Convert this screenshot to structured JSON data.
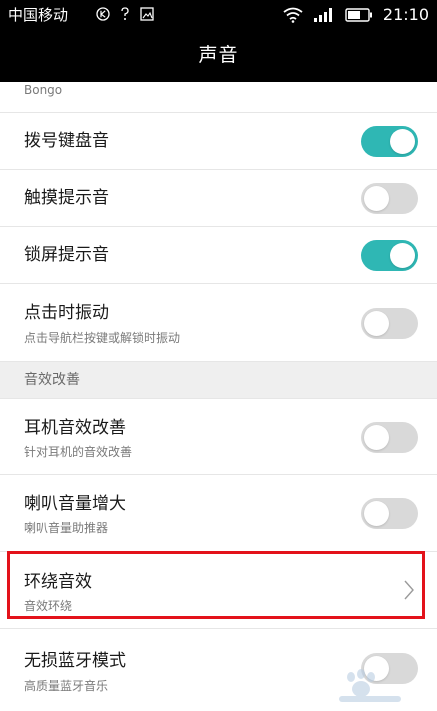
{
  "status_bar": {
    "carrier": "中国移动",
    "time": "21:10"
  },
  "header": {
    "title": "声音"
  },
  "partial_item": {
    "subtitle": "Bongo"
  },
  "items": [
    {
      "label": "拨号键盘音",
      "subtitle": "",
      "control": "toggle",
      "on": true
    },
    {
      "label": "触摸提示音",
      "subtitle": "",
      "control": "toggle",
      "on": false
    },
    {
      "label": "锁屏提示音",
      "subtitle": "",
      "control": "toggle",
      "on": true
    },
    {
      "label": "点击时振动",
      "subtitle": "点击导航栏按键或解锁时振动",
      "control": "toggle",
      "on": false
    }
  ],
  "section": {
    "label": "音效改善"
  },
  "section_items": [
    {
      "label": "耳机音效改善",
      "subtitle": "针对耳机的音效改善",
      "control": "toggle",
      "on": false
    },
    {
      "label": "喇叭音量增大",
      "subtitle": "喇叭音量助推器",
      "control": "toggle",
      "on": false
    },
    {
      "label": "环绕音效",
      "subtitle": "音效环绕",
      "control": "chevron"
    },
    {
      "label": "无损蓝牙模式",
      "subtitle": "高质量蓝牙音乐",
      "control": "toggle",
      "on": false
    }
  ],
  "colors": {
    "accent": "#2fb7b4",
    "toggle_off": "#d9d9d9",
    "highlight": "#e3121a",
    "bar": "#000000"
  }
}
